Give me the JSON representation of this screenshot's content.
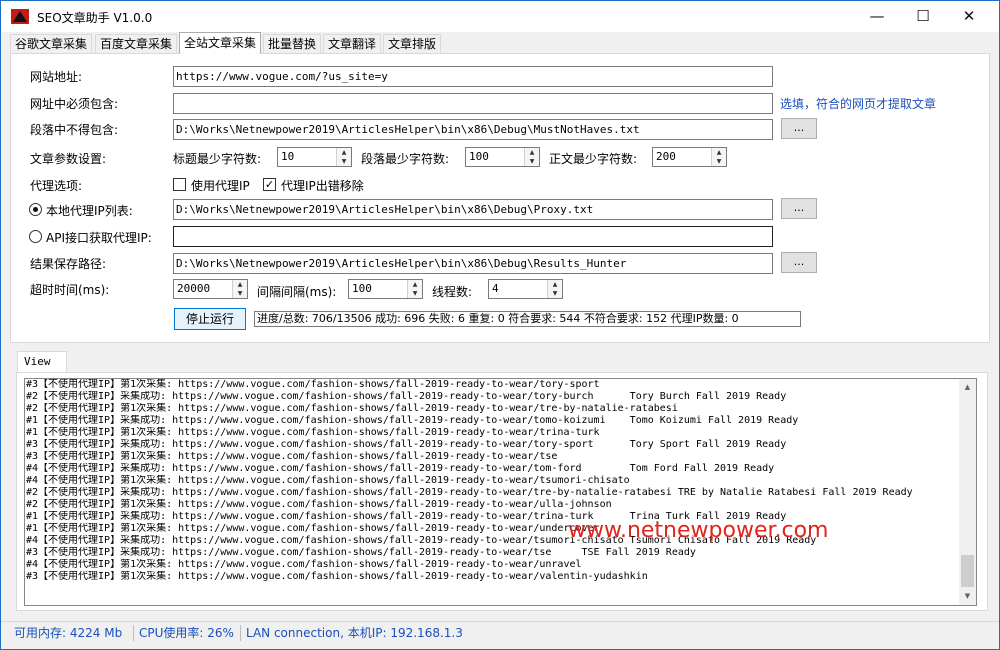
{
  "window": {
    "title": "SEO文章助手 V1.0.0"
  },
  "tabs": [
    {
      "label": "谷歌文章采集"
    },
    {
      "label": "百度文章采集"
    },
    {
      "label": "全站文章采集"
    },
    {
      "label": "批量替换"
    },
    {
      "label": "文章翻译"
    },
    {
      "label": "文章排版"
    }
  ],
  "active_tab": "全站文章采集",
  "form": {
    "site_url": {
      "label": "网站地址:",
      "value": "https://www.vogue.com/?us_site=y"
    },
    "must_contain": {
      "label": "网址中必须包含:",
      "value": "",
      "hint": "选填，符合的网页才提取文章"
    },
    "must_not": {
      "label": "段落中不得包含:",
      "value": "D:\\Works\\Netnewpower2019\\ArticlesHelper\\bin\\x86\\Debug\\MustNotHaves.txt",
      "browse": "..."
    },
    "params": {
      "label": "文章参数设置:",
      "title_min_label": "标题最少字符数:",
      "title_min": "10",
      "para_min_label": "段落最少字符数:",
      "para_min": "100",
      "body_min_label": "正文最少字符数:",
      "body_min": "200"
    },
    "proxy": {
      "label": "代理选项:",
      "use_proxy_label": "使用代理IP",
      "use_proxy": false,
      "remove_error_label": "代理IP出错移除",
      "remove_error": true
    },
    "local_proxy": {
      "label": "本地代理IP列表:",
      "selected": true,
      "value": "D:\\Works\\Netnewpower2019\\ArticlesHelper\\bin\\x86\\Debug\\Proxy.txt",
      "browse": "..."
    },
    "api_proxy": {
      "label": "API接口获取代理IP:",
      "selected": false,
      "value": ""
    },
    "save_path": {
      "label": "结果保存路径:",
      "value": "D:\\Works\\Netnewpower2019\\ArticlesHelper\\bin\\x86\\Debug\\Results_Hunter",
      "browse": "..."
    },
    "timing": {
      "timeout_label": "超时时间(ms):",
      "timeout": "20000",
      "interval_label": "间隔间隔(ms):",
      "interval": "100",
      "threads_label": "线程数:",
      "threads": "4"
    },
    "stop_button": "停止运行",
    "progress_text": "进度/总数: 706/13506 成功: 696 失败: 6 重复: 0 符合要求: 544 不符合要求: 152 代理IP数量: 0"
  },
  "view": {
    "tab_label": "View",
    "log": [
      "#3【不使用代理IP】第1次采集: https://www.vogue.com/fashion-shows/fall-2019-ready-to-wear/tory-sport",
      "#2【不使用代理IP】采集成功: https://www.vogue.com/fashion-shows/fall-2019-ready-to-wear/tory-burch      Tory Burch Fall 2019 Ready",
      "#2【不使用代理IP】第1次采集: https://www.vogue.com/fashion-shows/fall-2019-ready-to-wear/tre-by-natalie-ratabesi",
      "#1【不使用代理IP】采集成功: https://www.vogue.com/fashion-shows/fall-2019-ready-to-wear/tomo-koizumi    Tomo Koizumi Fall 2019 Ready",
      "#1【不使用代理IP】第1次采集: https://www.vogue.com/fashion-shows/fall-2019-ready-to-wear/trina-turk",
      "#3【不使用代理IP】采集成功: https://www.vogue.com/fashion-shows/fall-2019-ready-to-wear/tory-sport      Tory Sport Fall 2019 Ready",
      "#3【不使用代理IP】第1次采集: https://www.vogue.com/fashion-shows/fall-2019-ready-to-wear/tse",
      "#4【不使用代理IP】采集成功: https://www.vogue.com/fashion-shows/fall-2019-ready-to-wear/tom-ford        Tom Ford Fall 2019 Ready",
      "#4【不使用代理IP】第1次采集: https://www.vogue.com/fashion-shows/fall-2019-ready-to-wear/tsumori-chisato",
      "#2【不使用代理IP】采集成功: https://www.vogue.com/fashion-shows/fall-2019-ready-to-wear/tre-by-natalie-ratabesi TRE by Natalie Ratabesi Fall 2019 Ready",
      "#2【不使用代理IP】第1次采集: https://www.vogue.com/fashion-shows/fall-2019-ready-to-wear/ulla-johnson",
      "#1【不使用代理IP】采集成功: https://www.vogue.com/fashion-shows/fall-2019-ready-to-wear/trina-turk      Trina Turk Fall 2019 Ready",
      "#1【不使用代理IP】第1次采集: https://www.vogue.com/fashion-shows/fall-2019-ready-to-wear/undercover",
      "#4【不使用代理IP】采集成功: https://www.vogue.com/fashion-shows/fall-2019-ready-to-wear/tsumori-chisato Tsumori Chisato Fall 2019 Ready",
      "#3【不使用代理IP】采集成功: https://www.vogue.com/fashion-shows/fall-2019-ready-to-wear/tse     TSE Fall 2019 Ready",
      "#4【不使用代理IP】第1次采集: https://www.vogue.com/fashion-shows/fall-2019-ready-to-wear/unravel",
      "#3【不使用代理IP】第1次采集: https://www.vogue.com/fashion-shows/fall-2019-ready-to-wear/valentin-yudashkin"
    ],
    "watermark": "www.netnewpower.com"
  },
  "status": {
    "memory": "可用内存: 4224 Mb",
    "cpu": "CPU使用率: 26%",
    "network": "LAN connection,  本机IP: 192.168.1.3"
  },
  "colors": {
    "accent": "#1a6fc7",
    "link": "#1a4fbd",
    "watermark": "#e0251b"
  }
}
